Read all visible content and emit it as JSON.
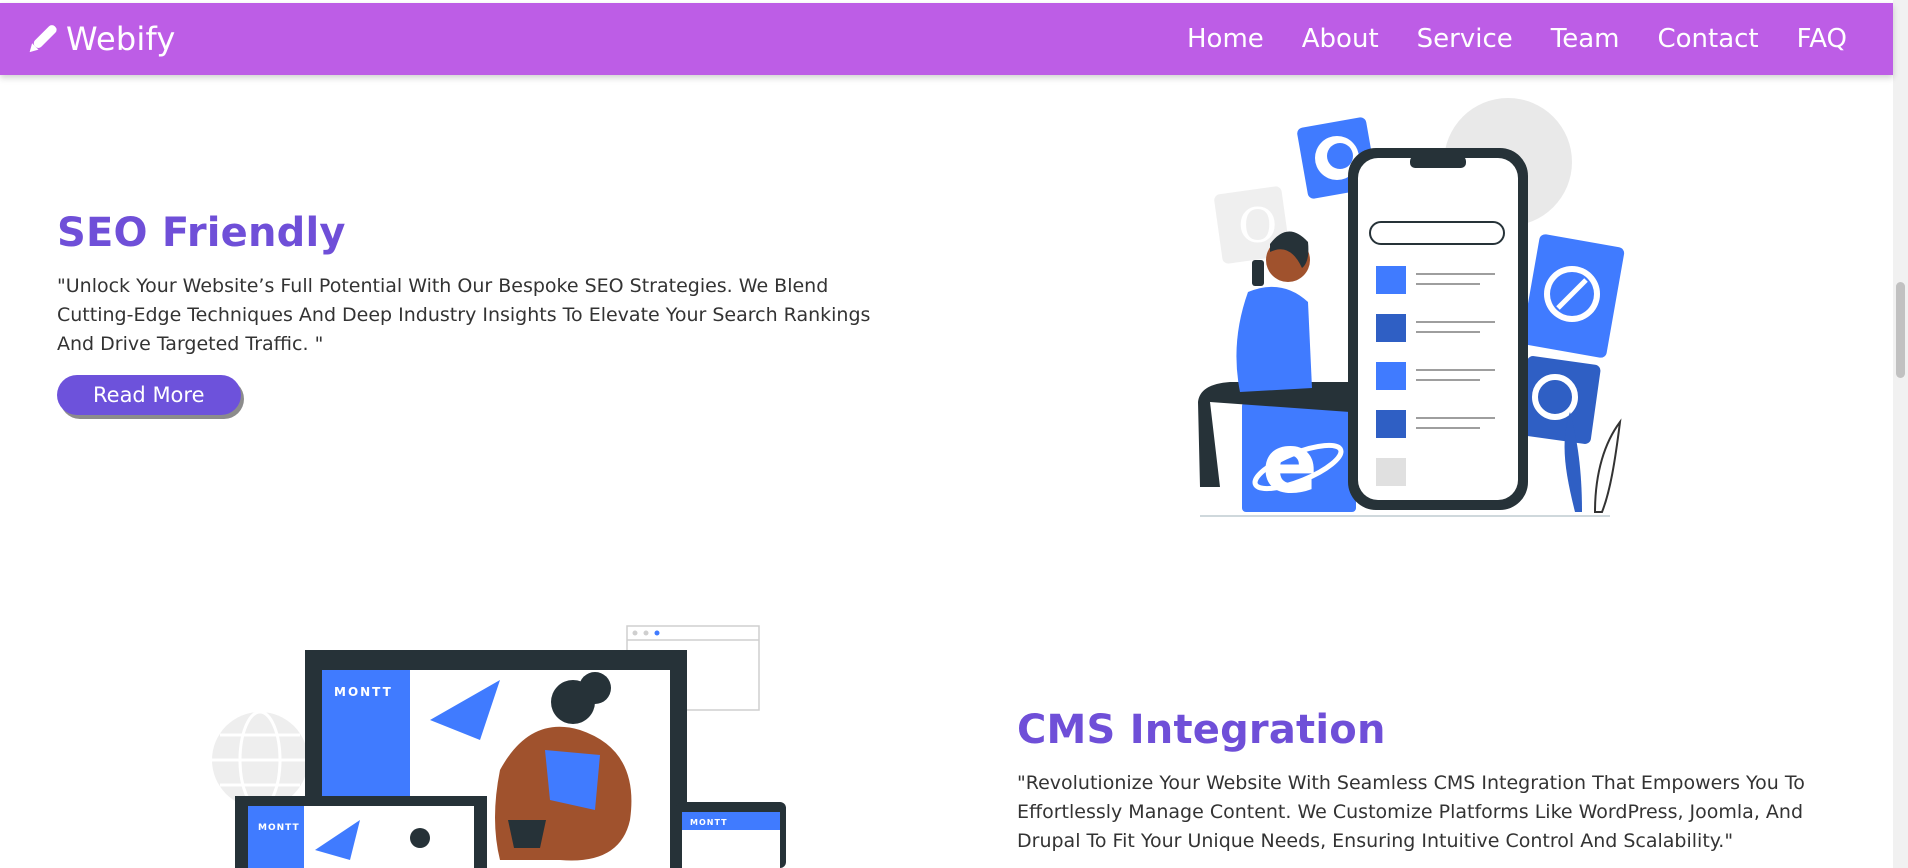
{
  "nav": {
    "brand": "Webify",
    "brand_icon": "pencil-icon",
    "links": [
      "Home",
      "About",
      "Service",
      "Team",
      "Contact",
      "FAQ"
    ]
  },
  "features": [
    {
      "title": "SEO Friendly",
      "description": "\"Unlock Your Website’s Full Potential With Our Bespoke SEO Strategies. We Blend Cutting-Edge Techniques And Deep Industry Insights To Elevate Your Search Rankings And Drive Targeted Traffic. \"",
      "button": "Read More"
    },
    {
      "title": "CMS Integration",
      "description": "\"Revolutionize Your Website With Seamless CMS Integration That Empowers You To Effortlessly Manage Content. We Customize Platforms Like WordPress, Joomla, And Drupal To Fit Your Unique Needs, Ensuring Intuitive Control And Scalability.\""
    }
  ],
  "illustration2": {
    "brand_text": "MONTT"
  },
  "colors": {
    "navbar": "#bd5de6",
    "accent": "#6f4fd8",
    "button": "#6d52db",
    "illustration_blue": "#407bff"
  }
}
